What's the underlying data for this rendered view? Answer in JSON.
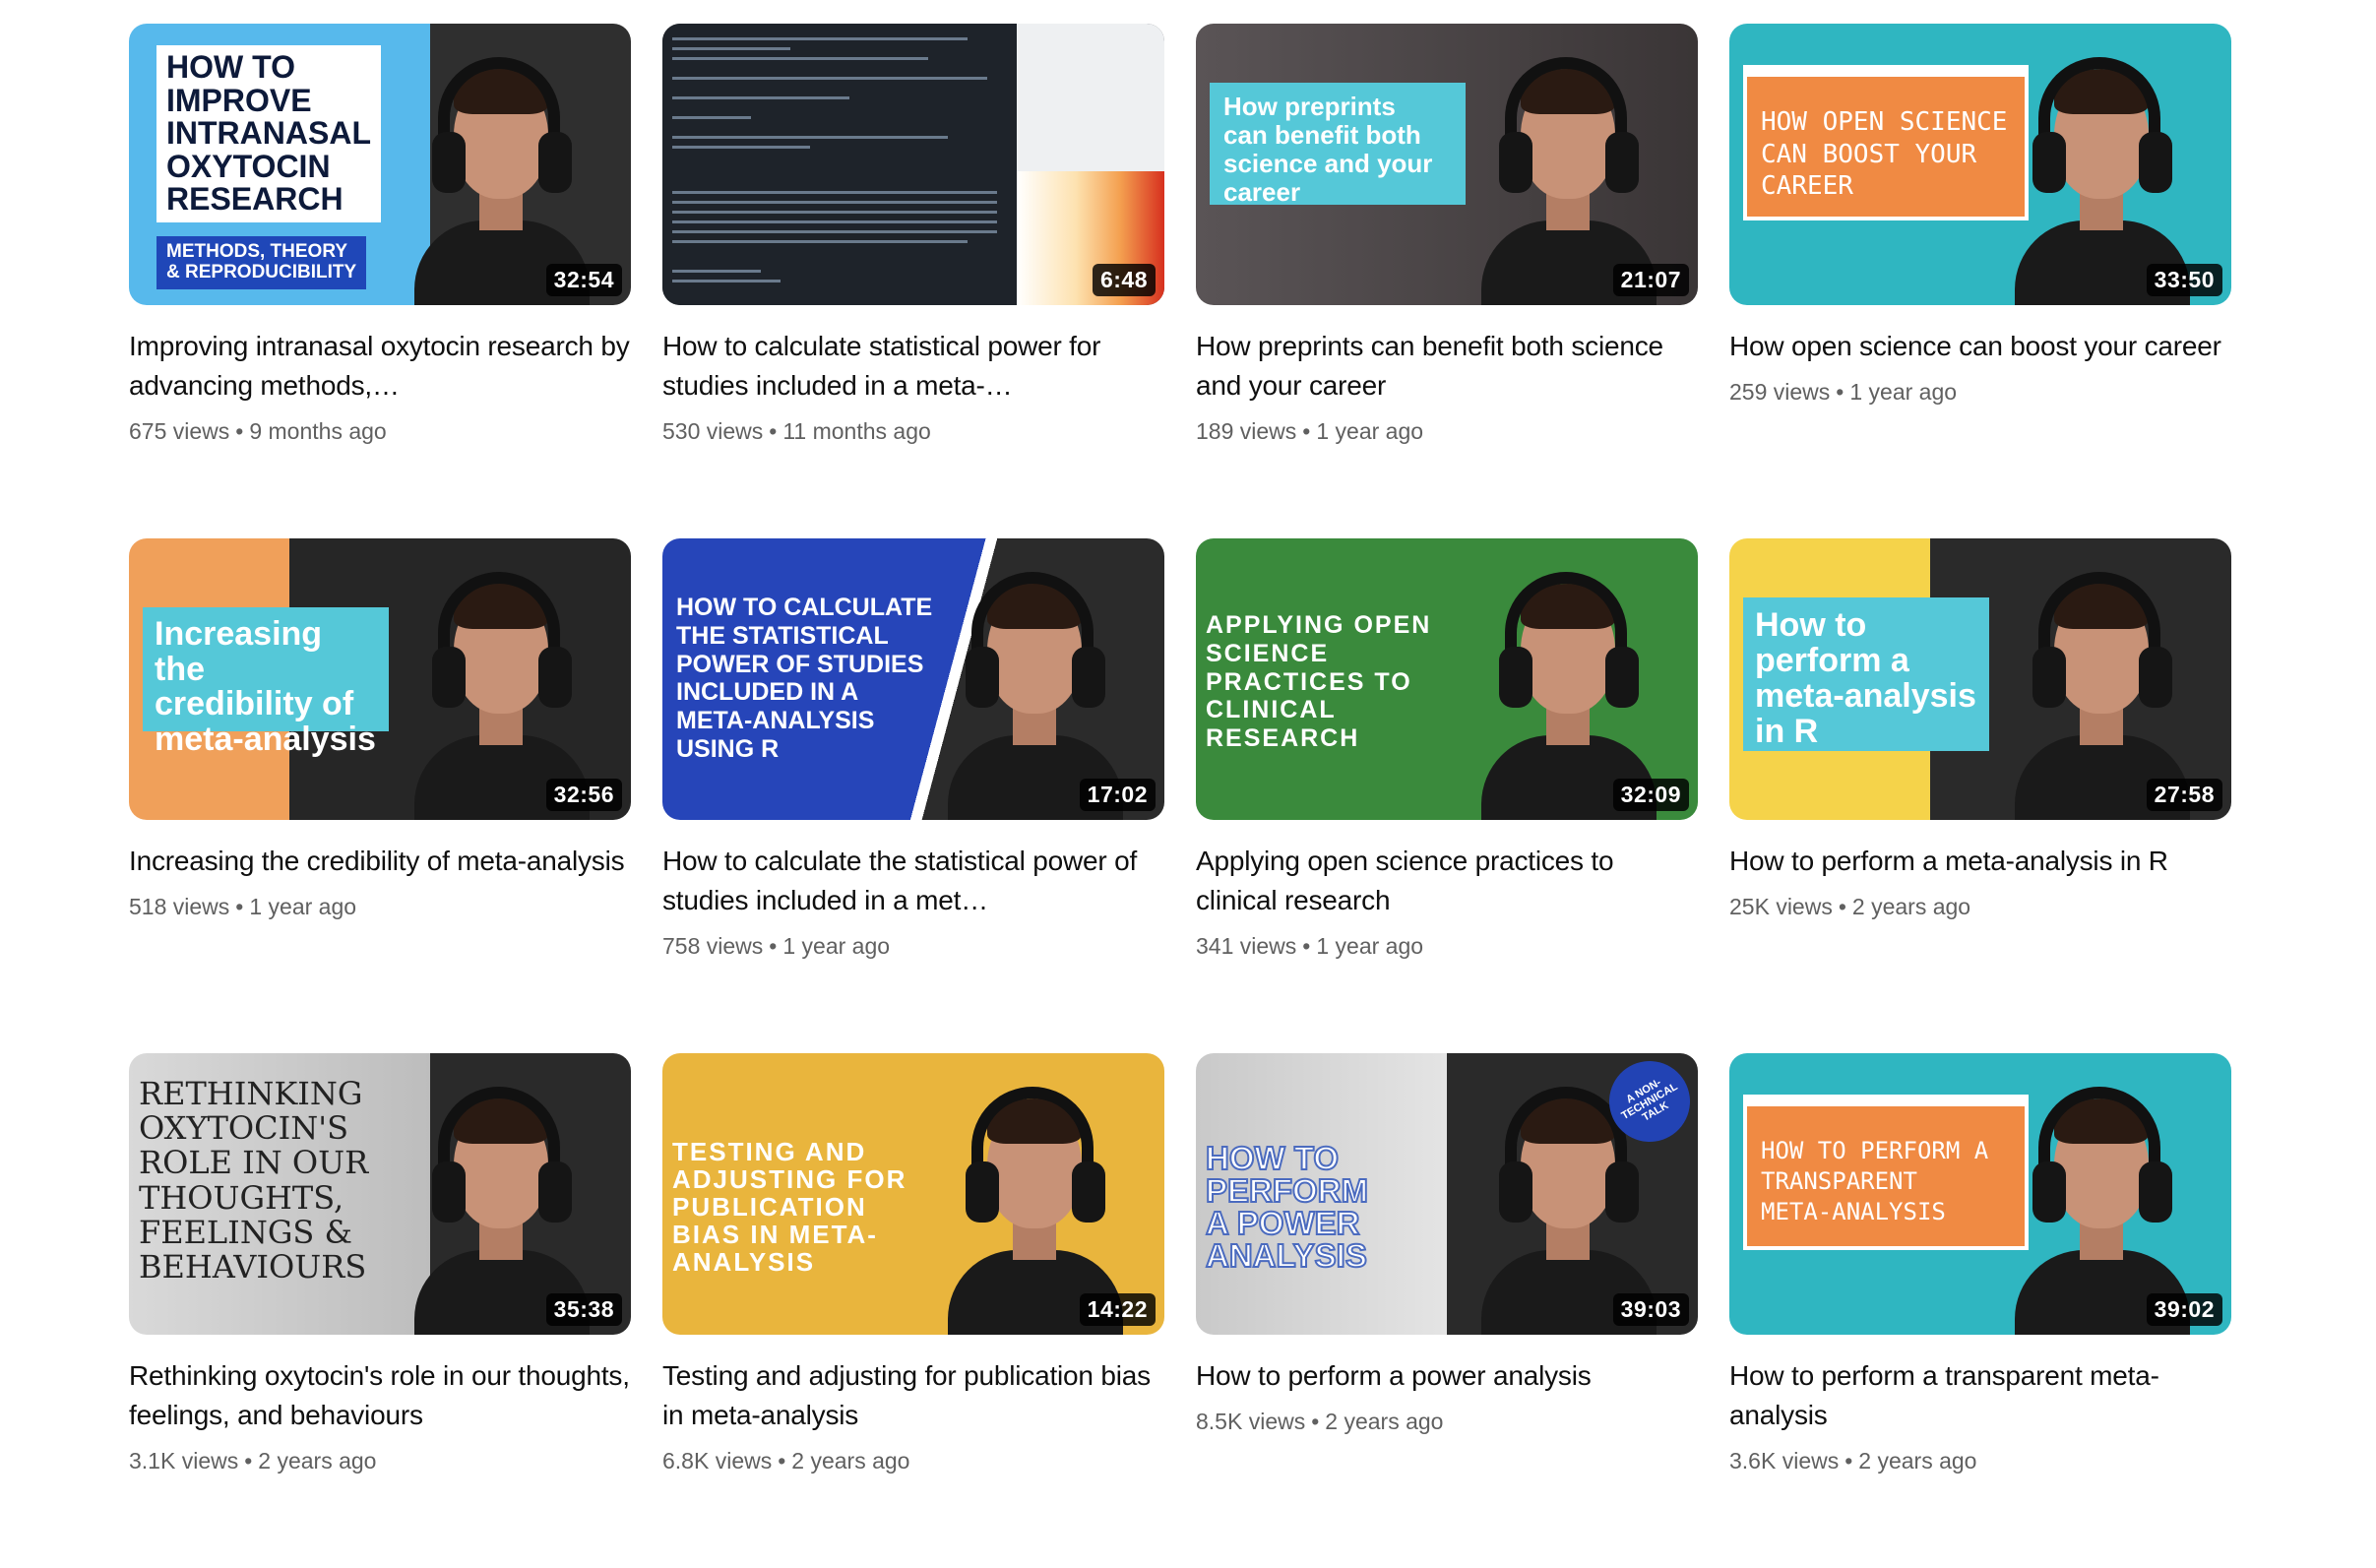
{
  "videos": [
    {
      "title": "Improving intranasal oxytocin research by advancing methods,…",
      "views": "675 views",
      "age": "9 months ago",
      "duration": "32:54",
      "thumb_text": "HOW TO\nIMPROVE\nINTRANASAL\nOXYTOCIN\nRESEARCH",
      "thumb_sub": "METHODS, THEORY\n& REPRODUCIBILITY"
    },
    {
      "title": "How to calculate statistical power for studies included in a meta-…",
      "views": "530 views",
      "age": "11 months ago",
      "duration": "6:48"
    },
    {
      "title": "How preprints can benefit both science and your career",
      "views": "189 views",
      "age": "1 year ago",
      "duration": "21:07",
      "thumb_text": "How preprints\ncan benefit both\nscience and your\ncareer"
    },
    {
      "title": "How open science can boost your career",
      "views": "259 views",
      "age": "1 year ago",
      "duration": "33:50",
      "thumb_text": "HOW OPEN SCIENCE\nCAN BOOST YOUR\nCAREER"
    },
    {
      "title": "Increasing the credibility of meta-analysis",
      "views": "518 views",
      "age": "1 year ago",
      "duration": "32:56",
      "thumb_text": "Increasing the\ncredibility of\nmeta-analysis"
    },
    {
      "title": "How to calculate the statistical power of studies included in a met…",
      "views": "758 views",
      "age": "1 year ago",
      "duration": "17:02",
      "thumb_text": "HOW TO CALCULATE\nTHE STATISTICAL\nPOWER OF STUDIES\nINCLUDED IN A\nMETA-ANALYSIS\nUSING R"
    },
    {
      "title": "Applying open science practices to clinical research",
      "views": "341 views",
      "age": "1 year ago",
      "duration": "32:09",
      "thumb_text": "APPLYING OPEN\nSCIENCE\nPRACTICES TO\nCLINICAL\nRESEARCH"
    },
    {
      "title": "How to perform a meta-analysis in R",
      "views": "25K views",
      "age": "2 years ago",
      "duration": "27:58",
      "thumb_text": "How to\nperform a\nmeta-analysis\nin R"
    },
    {
      "title": "Rethinking oxytocin's role in our thoughts, feelings, and behaviours",
      "views": "3.1K views",
      "age": "2 years ago",
      "duration": "35:38",
      "thumb_text": "RETHINKING\nOXYTOCIN'S\nROLE IN OUR\nTHOUGHTS,\nFEELINGS &\nBEHAVIOURS"
    },
    {
      "title": "Testing and adjusting for publication bias in meta-analysis",
      "views": "6.8K views",
      "age": "2 years ago",
      "duration": "14:22",
      "thumb_text": "TESTING AND\nADJUSTING FOR\nPUBLICATION\nBIAS IN META-\nANALYSIS"
    },
    {
      "title": "How to perform a power analysis",
      "views": "8.5K views",
      "age": "2 years ago",
      "duration": "39:03",
      "thumb_text": "HOW TO\nPERFORM\nA POWER\nANALYSIS",
      "sticker": "A NON-\nTECHNICAL\nTALK"
    },
    {
      "title": "How to perform a transparent meta-analysis",
      "views": "3.6K views",
      "age": "2 years ago",
      "duration": "39:02",
      "thumb_text": "HOW TO PERFORM A\nTRANSPARENT\nMETA-ANALYSIS"
    }
  ],
  "separator": "•"
}
